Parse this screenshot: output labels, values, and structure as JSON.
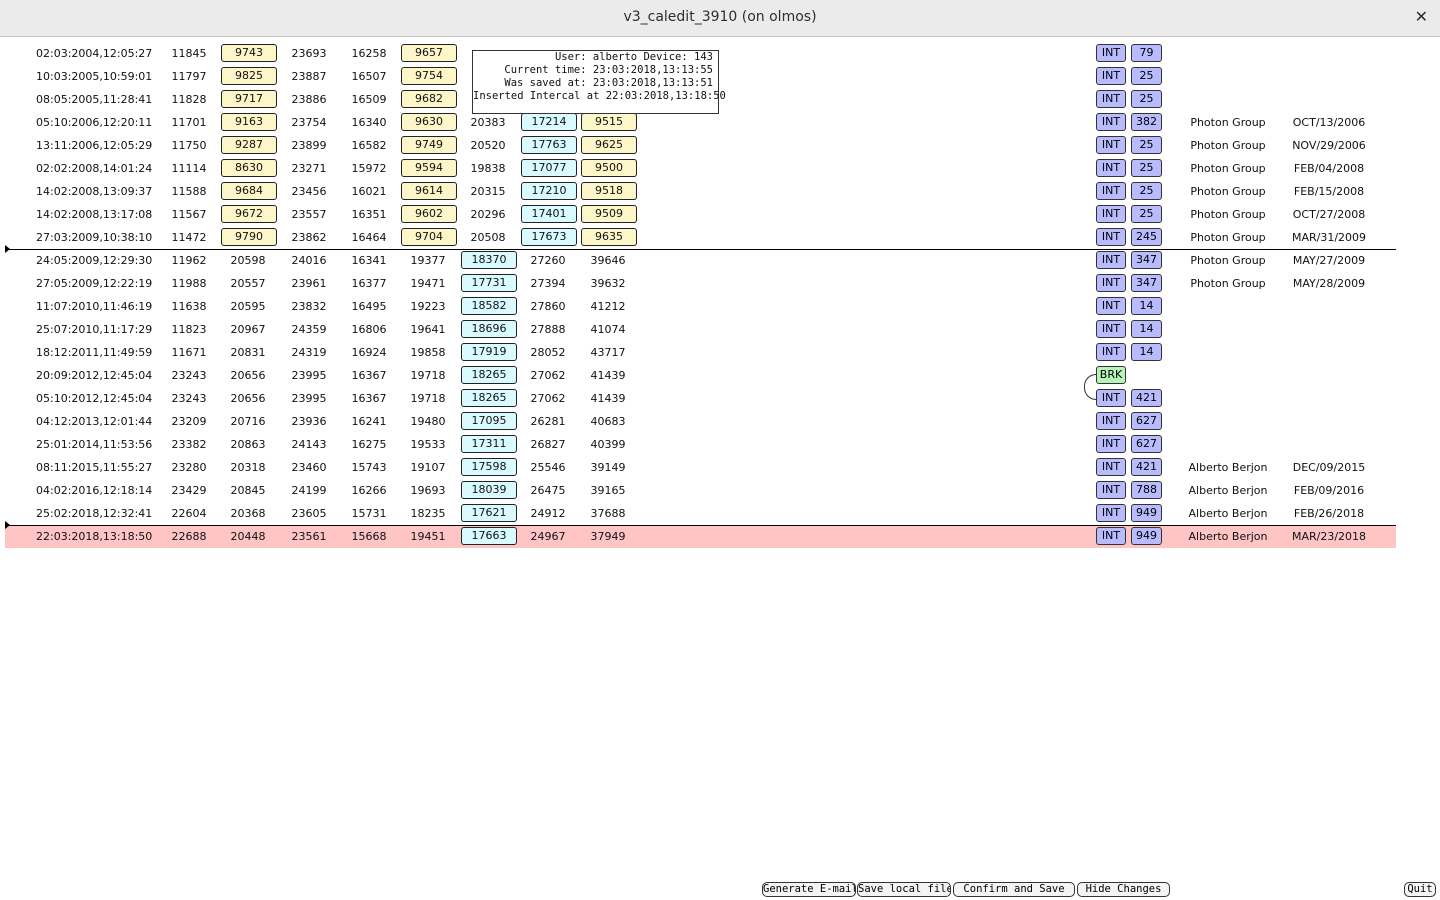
{
  "window": {
    "title": "v3_caledit_3910 (on olmos)",
    "close_icon": "close-icon"
  },
  "tooltip": {
    "lines": [
      "User: alberto Device: 143",
      "Current time: 23:03:2018,13:13:55",
      "Was saved at: 23:03:2018,13:13:51",
      "Inserted Intercal at 22:03:2018,13:18:50"
    ]
  },
  "rows": [
    {
      "date": "02:03:2004,12:05:27",
      "c1": "11845",
      "c2": "9743",
      "c3": "23693",
      "c4": "16258",
      "c5": "9657",
      "c6": "",
      "c7": "",
      "c8": "",
      "type": "INT",
      "num": "79",
      "author": "",
      "dstamp": ""
    },
    {
      "date": "10:03:2005,10:59:01",
      "c1": "11797",
      "c2": "9825",
      "c3": "23887",
      "c4": "16507",
      "c5": "9754",
      "c6": "",
      "c7": "",
      "c8": "",
      "type": "INT",
      "num": "25",
      "author": "",
      "dstamp": ""
    },
    {
      "date": "08:05:2005,11:28:41",
      "c1": "11828",
      "c2": "9717",
      "c3": "23886",
      "c4": "16509",
      "c5": "9682",
      "c6": "",
      "c7": "",
      "c8": "",
      "type": "INT",
      "num": "25",
      "author": "",
      "dstamp": ""
    },
    {
      "date": "05:10:2006,12:20:11",
      "c1": "11701",
      "c2": "9163",
      "c3": "23754",
      "c4": "16340",
      "c5": "9630",
      "c6": "20383",
      "c7": "17214",
      "c8": "9515",
      "type": "INT",
      "num": "382",
      "author": "Photon Group",
      "dstamp": "OCT/13/2006"
    },
    {
      "date": "13:11:2006,12:05:29",
      "c1": "11750",
      "c2": "9287",
      "c3": "23899",
      "c4": "16582",
      "c5": "9749",
      "c6": "20520",
      "c7": "17763",
      "c8": "9625",
      "type": "INT",
      "num": "25",
      "author": "Photon Group",
      "dstamp": "NOV/29/2006"
    },
    {
      "date": "02:02:2008,14:01:24",
      "c1": "11114",
      "c2": "8630",
      "c3": "23271",
      "c4": "15972",
      "c5": "9594",
      "c6": "19838",
      "c7": "17077",
      "c8": "9500",
      "type": "INT",
      "num": "25",
      "author": "Photon Group",
      "dstamp": "FEB/04/2008"
    },
    {
      "date": "14:02:2008,13:09:37",
      "c1": "11588",
      "c2": "9684",
      "c3": "23456",
      "c4": "16021",
      "c5": "9614",
      "c6": "20315",
      "c7": "17210",
      "c8": "9518",
      "type": "INT",
      "num": "25",
      "author": "Photon Group",
      "dstamp": "FEB/15/2008"
    },
    {
      "date": "14:02:2008,13:17:08",
      "c1": "11567",
      "c2": "9672",
      "c3": "23557",
      "c4": "16351",
      "c5": "9602",
      "c6": "20296",
      "c7": "17401",
      "c8": "9509",
      "type": "INT",
      "num": "25",
      "author": "Photon Group",
      "dstamp": "OCT/27/2008"
    },
    {
      "date": "27:03:2009,10:38:10",
      "c1": "11472",
      "c2": "9790",
      "c3": "23862",
      "c4": "16464",
      "c5": "9704",
      "c6": "20508",
      "c7": "17673",
      "c8": "9635",
      "type": "INT",
      "num": "245",
      "author": "Photon Group",
      "dstamp": "MAR/31/2009"
    },
    {
      "date": "24:05:2009,12:29:30",
      "c1": "11962",
      "c2": "20598",
      "c3": "24016",
      "c4": "16341",
      "c5": "19377",
      "c6": "18370",
      "c7": "27260",
      "c8": "39646",
      "type": "INT",
      "num": "347",
      "author": "Photon Group",
      "dstamp": "MAY/27/2009"
    },
    {
      "date": "27:05:2009,12:22:19",
      "c1": "11988",
      "c2": "20557",
      "c3": "23961",
      "c4": "16377",
      "c5": "19471",
      "c6": "17731",
      "c7": "27394",
      "c8": "39632",
      "type": "INT",
      "num": "347",
      "author": "Photon Group",
      "dstamp": "MAY/28/2009"
    },
    {
      "date": "11:07:2010,11:46:19",
      "c1": "11638",
      "c2": "20595",
      "c3": "23832",
      "c4": "16495",
      "c5": "19223",
      "c6": "18582",
      "c7": "27860",
      "c8": "41212",
      "type": "INT",
      "num": "14",
      "author": "",
      "dstamp": ""
    },
    {
      "date": "25:07:2010,11:17:29",
      "c1": "11823",
      "c2": "20967",
      "c3": "24359",
      "c4": "16806",
      "c5": "19641",
      "c6": "18696",
      "c7": "27888",
      "c8": "41074",
      "type": "INT",
      "num": "14",
      "author": "",
      "dstamp": ""
    },
    {
      "date": "18:12:2011,11:49:59",
      "c1": "11671",
      "c2": "20831",
      "c3": "24319",
      "c4": "16924",
      "c5": "19858",
      "c6": "17919",
      "c7": "28052",
      "c8": "43717",
      "type": "INT",
      "num": "14",
      "author": "",
      "dstamp": ""
    },
    {
      "date": "20:09:2012,12:45:04",
      "c1": "23243",
      "c2": "20656",
      "c3": "23995",
      "c4": "16367",
      "c5": "19718",
      "c6": "18265",
      "c7": "27062",
      "c8": "41439",
      "type": "BRK",
      "num": "",
      "author": "",
      "dstamp": ""
    },
    {
      "date": "05:10:2012,12:45:04",
      "c1": "23243",
      "c2": "20656",
      "c3": "23995",
      "c4": "16367",
      "c5": "19718",
      "c6": "18265",
      "c7": "27062",
      "c8": "41439",
      "type": "INT",
      "num": "421",
      "author": "",
      "dstamp": ""
    },
    {
      "date": "04:12:2013,12:01:44",
      "c1": "23209",
      "c2": "20716",
      "c3": "23936",
      "c4": "16241",
      "c5": "19480",
      "c6": "17095",
      "c7": "26281",
      "c8": "40683",
      "type": "INT",
      "num": "627",
      "author": "",
      "dstamp": ""
    },
    {
      "date": "25:01:2014,11:53:56",
      "c1": "23382",
      "c2": "20863",
      "c3": "24143",
      "c4": "16275",
      "c5": "19533",
      "c6": "17311",
      "c7": "26827",
      "c8": "40399",
      "type": "INT",
      "num": "627",
      "author": "",
      "dstamp": ""
    },
    {
      "date": "08:11:2015,11:55:27",
      "c1": "23280",
      "c2": "20318",
      "c3": "23460",
      "c4": "15743",
      "c5": "19107",
      "c6": "17598",
      "c7": "25546",
      "c8": "39149",
      "type": "INT",
      "num": "421",
      "author": "Alberto Berjon",
      "dstamp": "DEC/09/2015"
    },
    {
      "date": "04:02:2016,12:18:14",
      "c1": "23429",
      "c2": "20845",
      "c3": "24199",
      "c4": "16266",
      "c5": "19693",
      "c6": "18039",
      "c7": "26475",
      "c8": "39165",
      "type": "INT",
      "num": "788",
      "author": "Alberto Berjon",
      "dstamp": "FEB/09/2016"
    },
    {
      "date": "25:02:2018,12:32:41",
      "c1": "22604",
      "c2": "20368",
      "c3": "23605",
      "c4": "15731",
      "c5": "18235",
      "c6": "17621",
      "c7": "24912",
      "c8": "37688",
      "type": "INT",
      "num": "949",
      "author": "Alberto Berjon",
      "dstamp": "FEB/26/2018"
    },
    {
      "date": "22:03:2018,13:18:50",
      "c1": "22688",
      "c2": "20448",
      "c3": "23561",
      "c4": "15668",
      "c5": "19451",
      "c6": "17663",
      "c7": "24967",
      "c8": "37949",
      "type": "INT",
      "num": "949",
      "author": "Alberto Berjon",
      "dstamp": "MAR/23/2018"
    }
  ],
  "buttons": {
    "generate_email": "Generate E-mail",
    "save_local": "Save local file",
    "confirm_save": "Confirm and Save",
    "hide_changes": "Hide Changes",
    "quit": "Quit"
  },
  "colors": {
    "highlight_row": "#ffc4c4",
    "yellow_box": "#fdf6c8",
    "cyan_box": "#d9fbff",
    "int_tag": "#b8bcff",
    "brk_tag": "#b8f4b8"
  }
}
